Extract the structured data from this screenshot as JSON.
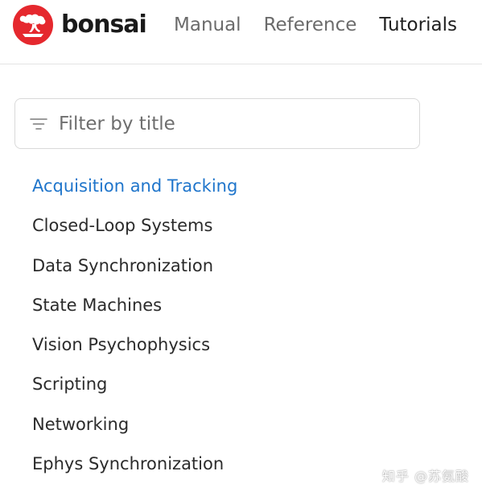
{
  "header": {
    "brand": "bonsai",
    "brand_color": "#e5282e",
    "nav": [
      {
        "label": "Manual",
        "active": false
      },
      {
        "label": "Reference",
        "active": false
      },
      {
        "label": "Tutorials",
        "active": true
      }
    ]
  },
  "sidebar": {
    "filter": {
      "placeholder": "Filter by title",
      "value": "",
      "icon": "filter-icon"
    },
    "items": [
      {
        "label": "Acquisition and Tracking",
        "active": true
      },
      {
        "label": "Closed-Loop Systems",
        "active": false
      },
      {
        "label": "Data Synchronization",
        "active": false
      },
      {
        "label": "State Machines",
        "active": false
      },
      {
        "label": "Vision Psychophysics",
        "active": false
      },
      {
        "label": "Scripting",
        "active": false
      },
      {
        "label": "Networking",
        "active": false
      },
      {
        "label": "Ephys Synchronization",
        "active": false
      }
    ]
  },
  "watermark": "知乎 @苏氨酸",
  "colors": {
    "active_link": "#1f75cb",
    "text": "#2b2b2b",
    "nav_inactive": "#6b6b6b"
  }
}
